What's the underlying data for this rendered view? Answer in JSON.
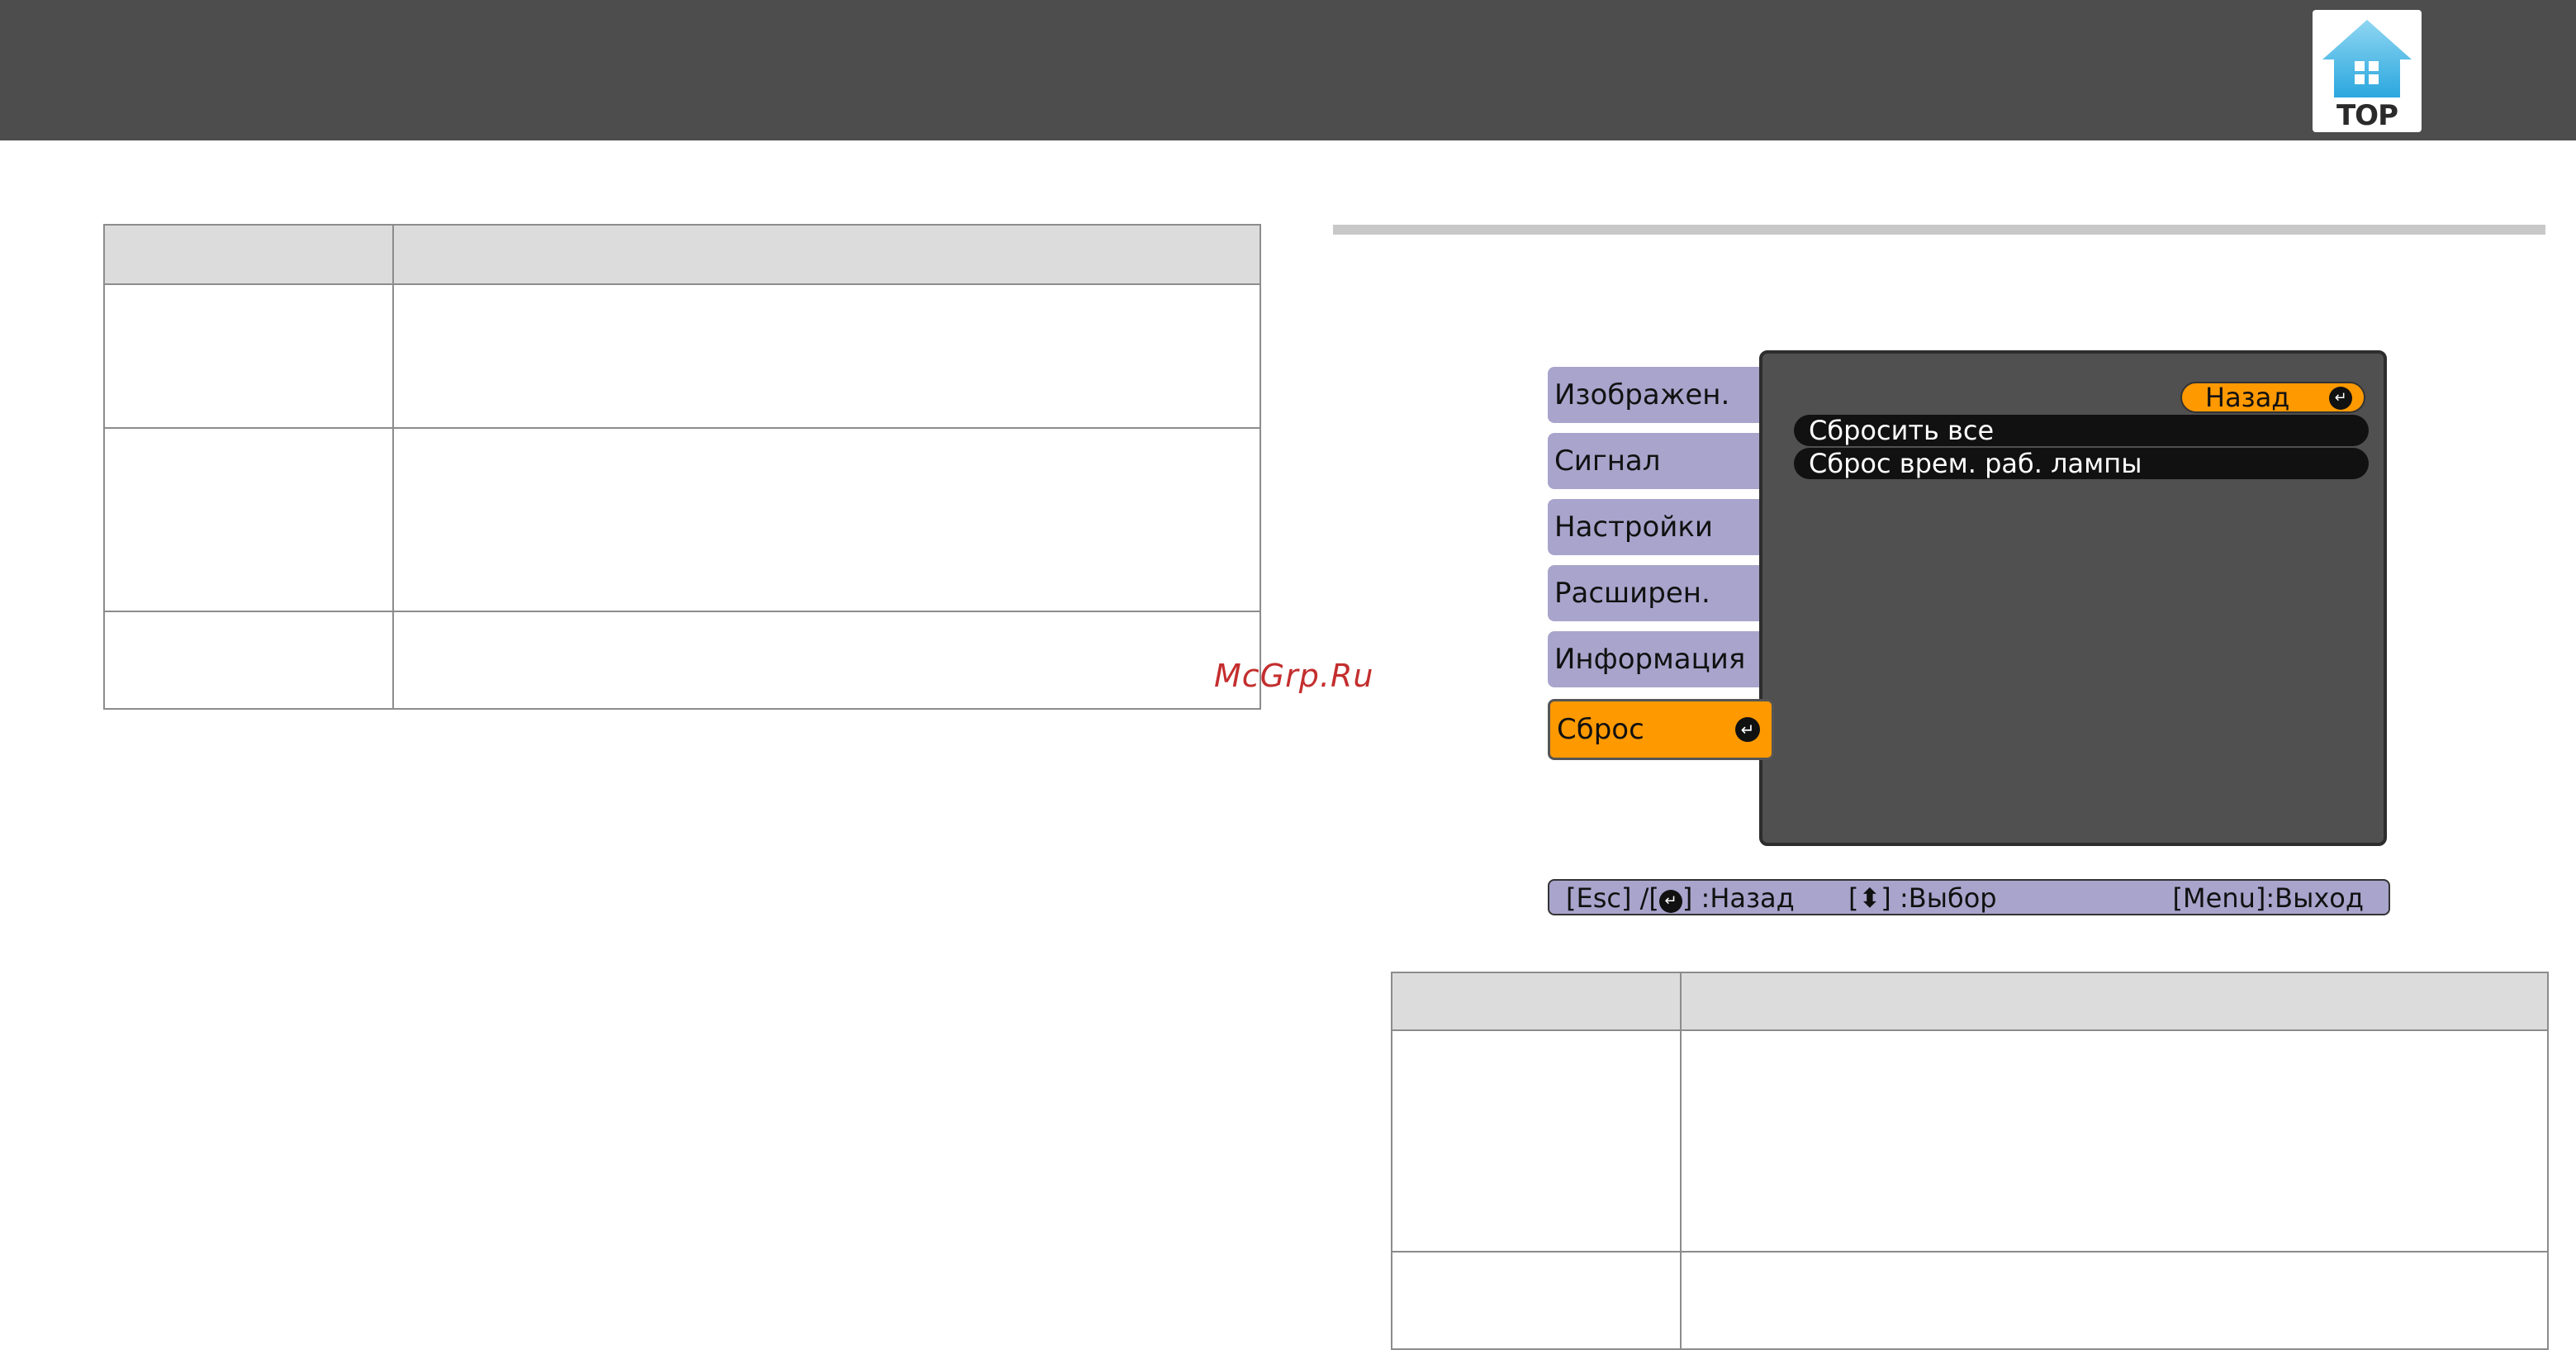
{
  "header": {
    "logo_label": "TOP",
    "logo_icon": "house-icon"
  },
  "watermark": "McGrp.Ru",
  "osd": {
    "menu_tabs": [
      {
        "label": "Изображен."
      },
      {
        "label": "Сигнал"
      },
      {
        "label": "Настройки"
      },
      {
        "label": "Расширен."
      },
      {
        "label": "Информация"
      },
      {
        "label": "Сброс"
      }
    ],
    "active_tab": "Сброс",
    "back_button": "Назад",
    "items": [
      {
        "label": "Сбросить все"
      },
      {
        "label": "Сброс врем. раб. лампы"
      }
    ],
    "help": {
      "esc": "[Esc] /[",
      "back": "] :Назад",
      "select_open": "[",
      "select": "] :Выбор",
      "exit": "[Menu]:Выход"
    }
  },
  "colors": {
    "header_bg": "#4d4d4d",
    "tab_bg": "#a8a4cc",
    "active_tab": "#ff9900",
    "panel_bg": "#505050",
    "table_header_bg": "#dcdcdc"
  }
}
